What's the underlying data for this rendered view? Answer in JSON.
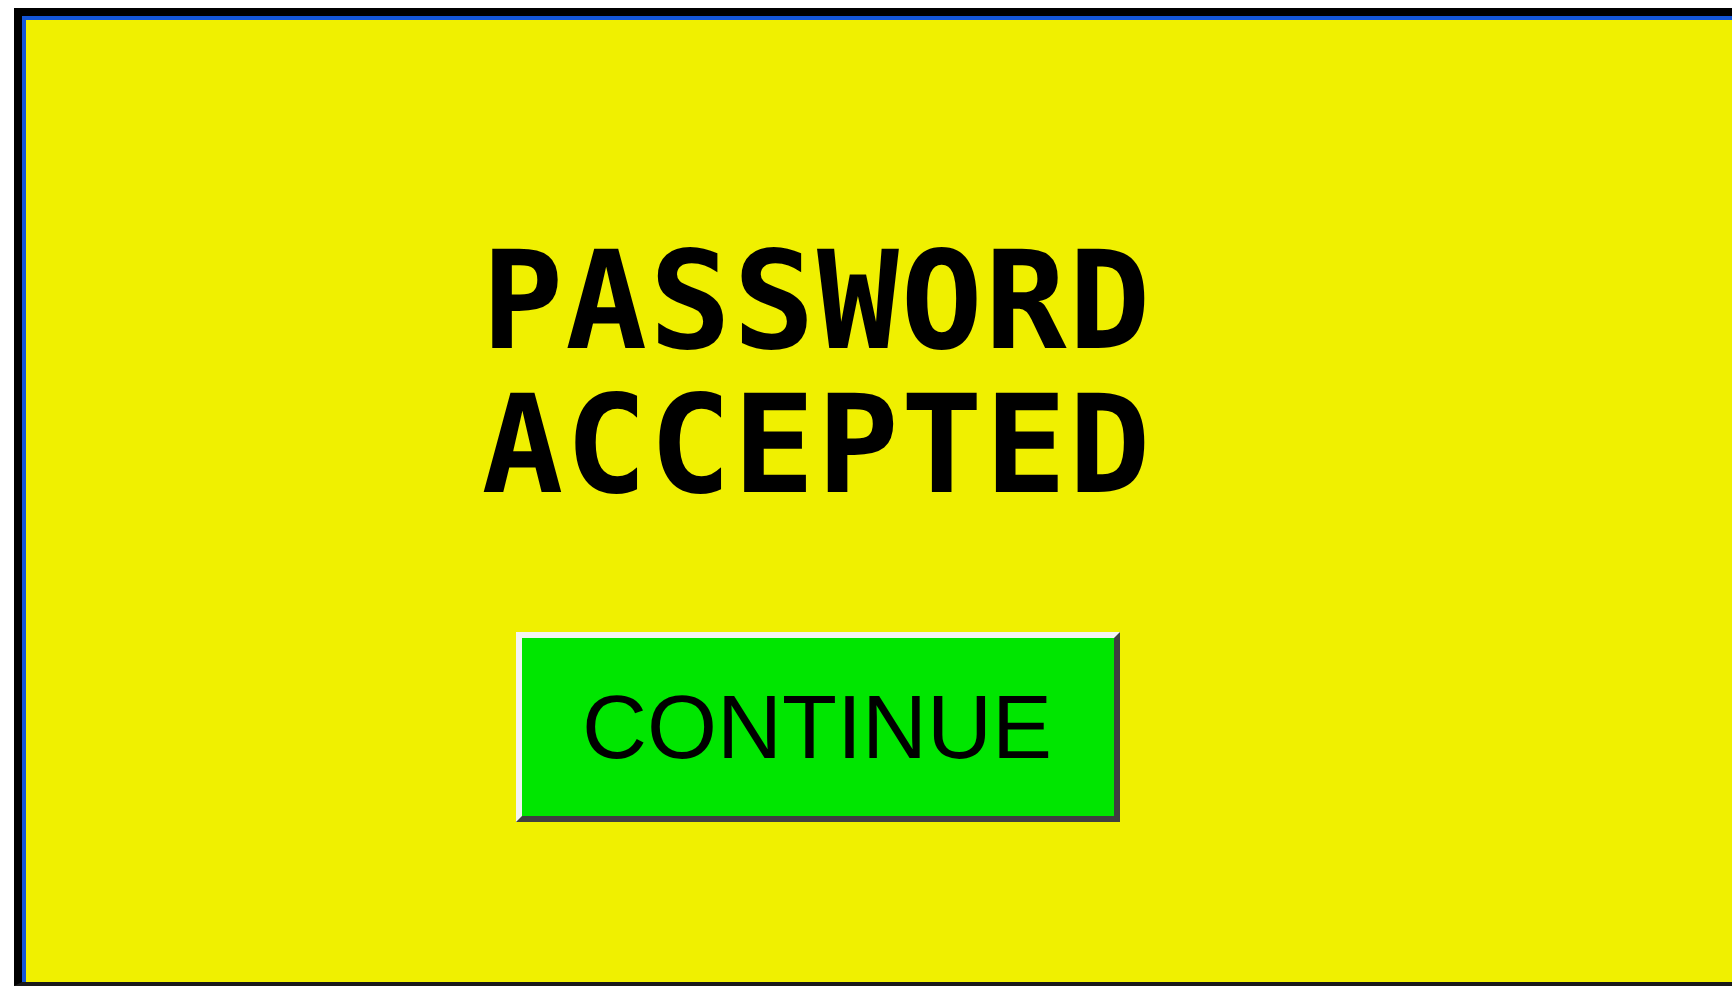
{
  "message": {
    "lines": [
      "PASSWORD",
      "ACCEPTED"
    ]
  },
  "buttons": [
    {
      "label": "CONTINUE"
    }
  ]
}
